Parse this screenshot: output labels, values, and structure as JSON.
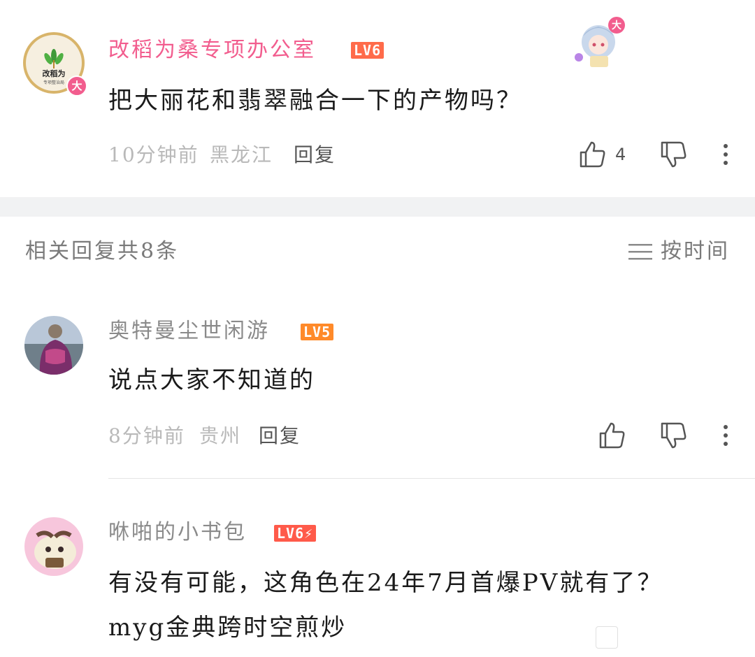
{
  "main_comment": {
    "username": "改稻为桑专项办公室",
    "level": "LV6",
    "avatar_text": "改稻为",
    "avatar_subtext": "专项整治局",
    "badge": "大",
    "text": "把大丽花和翡翠融合一下的产物吗？",
    "time": "10分钟前",
    "location": "黑龙江",
    "reply_label": "回复",
    "like_count": "4"
  },
  "decor_badge": "大",
  "replies_section": {
    "count_label": "相关回复共8条",
    "sort_label": "按时间"
  },
  "replies": [
    {
      "username": "奥特曼尘世闲游",
      "level": "LV5",
      "text": "说点大家不知道的",
      "time": "8分钟前",
      "location": "贵州",
      "reply_label": "回复"
    },
    {
      "username": "咻啪的小书包",
      "level": "LV6⚡",
      "text_line1": "有没有可能，这角色在24年7月首爆PV就有了？",
      "text_line2": "myg金典跨时空煎炒"
    }
  ],
  "icons": {
    "like": "thumbs-up-icon",
    "dislike": "thumbs-down-icon",
    "more": "more-vertical-icon",
    "sort": "sort-lines-icon"
  },
  "colors": {
    "username_vip": "#f25d8e",
    "username_normal": "#8a8a8a",
    "level_badge": "#ff6b4a",
    "divider_band": "#f1f2f3"
  }
}
